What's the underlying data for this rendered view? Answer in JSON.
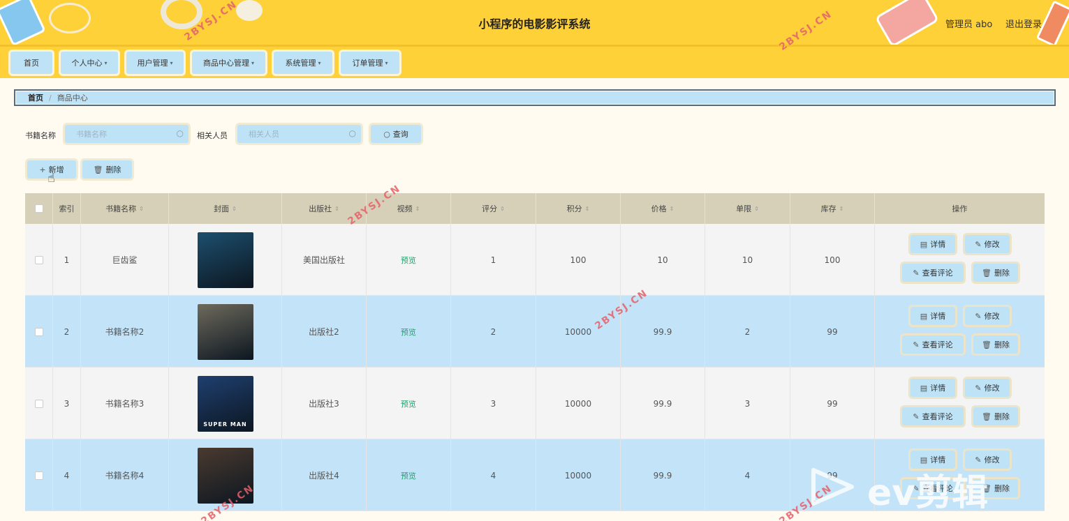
{
  "header": {
    "title": "小程序的电影影评系统",
    "user": "管理员 abo",
    "logout": "退出登录"
  },
  "nav": [
    {
      "label": "首页",
      "has_caret": false
    },
    {
      "label": "个人中心",
      "has_caret": true
    },
    {
      "label": "用户管理",
      "has_caret": true
    },
    {
      "label": "商品中心管理",
      "has_caret": true
    },
    {
      "label": "系统管理",
      "has_caret": true
    },
    {
      "label": "订单管理",
      "has_caret": true
    }
  ],
  "breadcrumb": {
    "home": "首页",
    "separator": "/",
    "current": "商品中心"
  },
  "search": {
    "name_label": "书籍名称",
    "name_placeholder": "书籍名称",
    "person_label": "相关人员",
    "person_placeholder": "相关人员",
    "query_label": "查询"
  },
  "actions": {
    "add_label": "新增",
    "delete_label": "删除"
  },
  "table": {
    "columns": [
      "索引",
      "书籍名称",
      "封面",
      "出版社",
      "视频",
      "评分",
      "积分",
      "价格",
      "单限",
      "库存",
      "操作"
    ],
    "rows": [
      {
        "index": "1",
        "name": "巨齿鲨",
        "publisher": "美国出版社",
        "video": "预览",
        "rating": "1",
        "points": "100",
        "price": "10",
        "limit": "10",
        "stock": "100",
        "poster_color": "#1d4f6e"
      },
      {
        "index": "2",
        "name": "书籍名称2",
        "publisher": "出版社2",
        "video": "预览",
        "rating": "2",
        "points": "10000",
        "price": "99.9",
        "limit": "2",
        "stock": "99",
        "poster_color": "#6e6a5c"
      },
      {
        "index": "3",
        "name": "书籍名称3",
        "publisher": "出版社3",
        "video": "预览",
        "rating": "3",
        "points": "10000",
        "price": "99.9",
        "limit": "3",
        "stock": "99",
        "poster_color": "#1f3f70",
        "poster_text": "SUPER MAN"
      },
      {
        "index": "4",
        "name": "书籍名称4",
        "publisher": "出版社4",
        "video": "预览",
        "rating": "4",
        "points": "10000",
        "price": "99.9",
        "limit": "4",
        "stock": "99",
        "poster_color": "#4a3a30"
      }
    ],
    "row_actions": {
      "detail": "详情",
      "edit": "修改",
      "comments": "查看评论",
      "delete": "删除"
    }
  },
  "watermark": "2BYSJ.CN",
  "overlay": {
    "brand": "ev剪辑"
  },
  "colors": {
    "header_bg": "#ffd139",
    "button_bg": "#bfe3f6",
    "row_alt": "#c3e4f8",
    "link_green": "#20a06c"
  }
}
